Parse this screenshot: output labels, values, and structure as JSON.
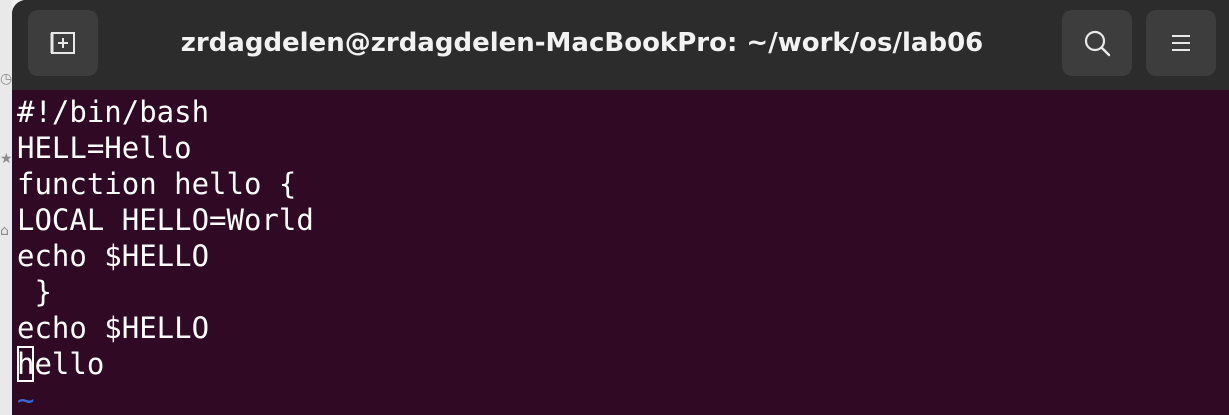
{
  "window": {
    "title": "zrdagdelen@zrdagdelen-MacBookPro: ~/work/os/lab06"
  },
  "titlebar": {
    "new_tab_icon": "new-tab-icon",
    "search_icon": "search-icon",
    "menu_icon": "hamburger-menu-icon"
  },
  "colors": {
    "terminal_bg": "#300a24",
    "titlebar_bg": "#2c2c2c",
    "button_bg": "#3d3d3d",
    "text": "#ffffff",
    "tilde": "#3b6ad6"
  },
  "editor": {
    "lines": [
      "#!/bin/bash",
      "HELL=Hello",
      "function hello {",
      "LOCAL HELLO=World",
      "echo $HELLO",
      " }",
      "echo $HELLO"
    ],
    "cursor_line_char": "h",
    "cursor_line_rest": "ello",
    "empty_marker": "~"
  }
}
